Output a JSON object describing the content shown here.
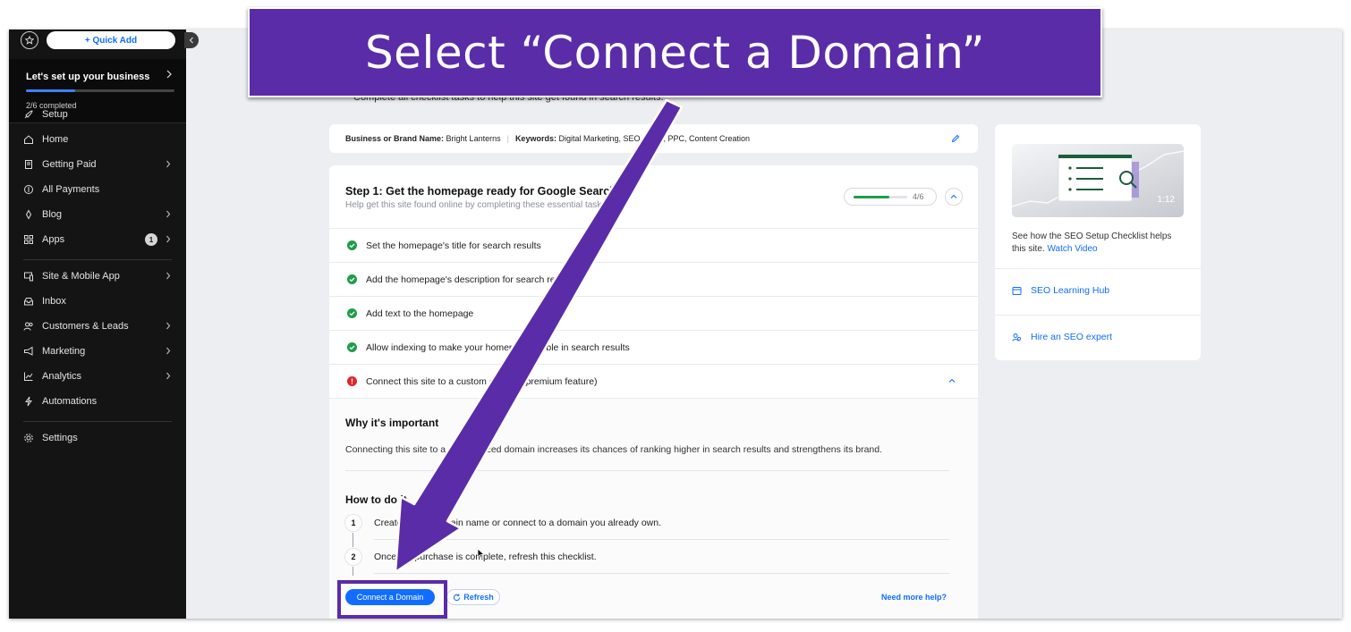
{
  "sidebar": {
    "quick_add_label": "+ Quick Add",
    "setup": {
      "title": "Let's set up your business",
      "completed": "2/6 completed",
      "progress_fraction": 0.333
    },
    "items": [
      {
        "label": "Setup",
        "icon": "rocket-icon"
      },
      {
        "label": "Home",
        "icon": "home-icon"
      },
      {
        "label": "Getting Paid",
        "icon": "receipt-icon"
      },
      {
        "label": "All Payments",
        "icon": "dollar-icon"
      },
      {
        "label": "Blog",
        "icon": "pen-icon"
      },
      {
        "label": "Apps",
        "icon": "apps-icon",
        "badge": "1"
      },
      {
        "label": "Site & Mobile App",
        "icon": "device-icon"
      },
      {
        "label": "Inbox",
        "icon": "inbox-icon"
      },
      {
        "label": "Customers & Leads",
        "icon": "people-icon"
      },
      {
        "label": "Marketing",
        "icon": "megaphone-icon"
      },
      {
        "label": "Analytics",
        "icon": "chart-icon"
      },
      {
        "label": "Automations",
        "icon": "bolt-icon"
      },
      {
        "label": "Settings",
        "icon": "gear-icon"
      }
    ]
  },
  "main": {
    "subtitle": "Complete all checklist tasks to help this site get found in search results.",
    "info_bar": {
      "brand_label": "Business or Brand Name:",
      "brand_value": "Bright Lanterns",
      "keywords_label": "Keywords:",
      "keywords_value": "Digital Marketing, SEO, SMM, PPC, Content Creation"
    },
    "step": {
      "title": "Step 1: Get the homepage ready for Google Search",
      "subtitle": "Help get this site found online by completing these essential tasks.",
      "progress_label": "4/6",
      "progress_fraction": 0.667,
      "tasks": [
        {
          "label": "Set the homepage's title for search results",
          "status": "done"
        },
        {
          "label": "Add the homepage's description for search results",
          "status": "done"
        },
        {
          "label": "Add text to the homepage",
          "status": "done"
        },
        {
          "label": "Allow indexing to make your homepage visible in search results",
          "status": "done"
        },
        {
          "label": "Connect this site to a custom domain (premium feature)",
          "status": "error"
        }
      ],
      "why_heading": "Why it's important",
      "why_text": "Connecting this site to a personalized domain increases its chances of ranking higher in search results and strengthens its brand.",
      "how_heading": "How to do it",
      "how_steps": [
        {
          "num": "1",
          "text": "Create a new domain name or connect to a domain you already own."
        },
        {
          "num": "2",
          "text": "Once the purchase is complete, refresh this checklist."
        }
      ],
      "primary_button": "Connect a Domain",
      "refresh_button": "Refresh",
      "help_link": "Need more help?"
    }
  },
  "side_panel": {
    "video_duration": "1:12",
    "video_text": "See how the SEO Setup Checklist helps this site.",
    "video_link": "Watch Video",
    "links": [
      {
        "label": "SEO Learning Hub",
        "icon": "hub-icon"
      },
      {
        "label": "Hire an SEO expert",
        "icon": "expert-icon"
      }
    ]
  },
  "overlay": {
    "banner_text": "Select “Connect a Domain”"
  },
  "colors": {
    "accent": "#116dff",
    "annotation": "#5a2ca8",
    "success": "#1e9e4a",
    "error": "#e0262b",
    "sidebar_bg": "#141414"
  }
}
